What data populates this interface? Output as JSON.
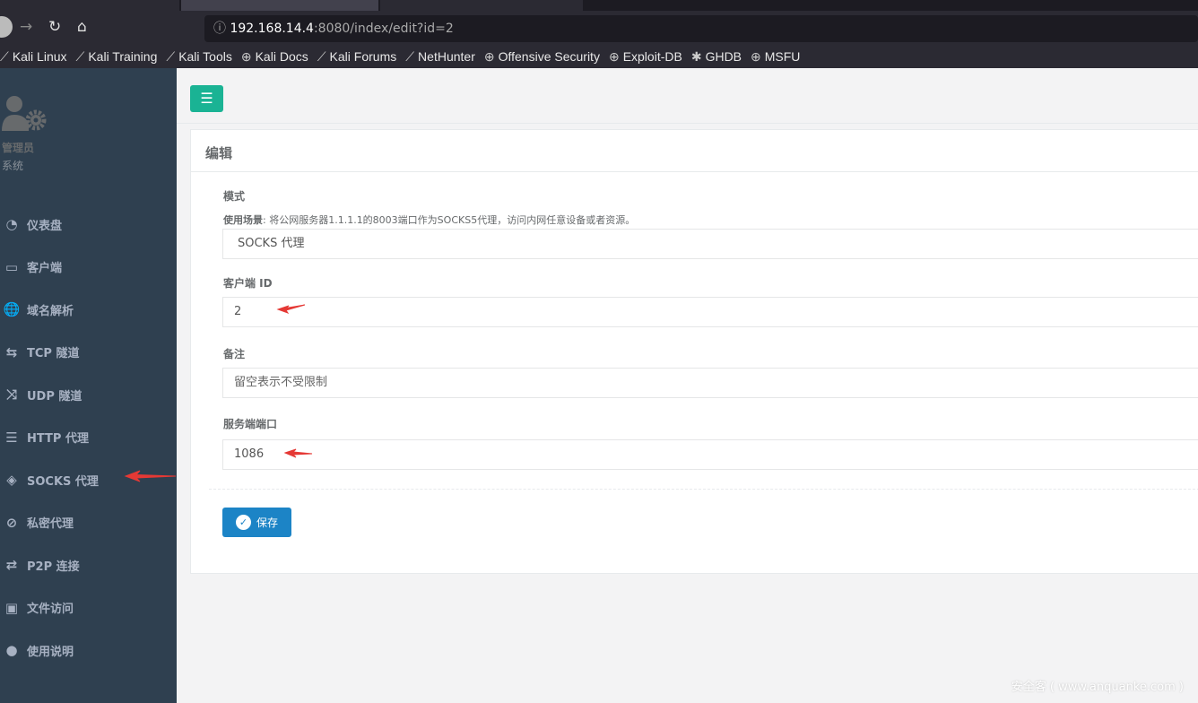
{
  "browser": {
    "url_host": "192.168.14.4",
    "url_rest": ":8080/index/edit?id=2",
    "bookmarks": [
      {
        "icon": "kali-dragon-icon",
        "label": "Kali Linux"
      },
      {
        "icon": "kali-dragon-icon",
        "label": "Kali Training"
      },
      {
        "icon": "kali-dragon-icon",
        "label": "Kali Tools"
      },
      {
        "icon": "globe-icon",
        "label": "Kali Docs"
      },
      {
        "icon": "kali-dragon-icon",
        "label": "Kali Forums"
      },
      {
        "icon": "kali-dragon-icon",
        "label": "NetHunter"
      },
      {
        "icon": "globe-icon",
        "label": "Offensive Security"
      },
      {
        "icon": "globe-icon",
        "label": "Exploit-DB"
      },
      {
        "icon": "ghdb-icon",
        "label": "GHDB"
      },
      {
        "icon": "globe-icon",
        "label": "MSFU"
      }
    ]
  },
  "profile": {
    "name": "管理员",
    "role": "系统"
  },
  "sidebar": {
    "items": [
      {
        "icon": "dashboard-icon",
        "label": "仪表盘"
      },
      {
        "icon": "desktop-icon",
        "label": "客户端"
      },
      {
        "icon": "globe-icon",
        "label": "域名解析"
      },
      {
        "icon": "retweet-icon",
        "label": "TCP 隧道"
      },
      {
        "icon": "random-icon",
        "label": "UDP 隧道"
      },
      {
        "icon": "server-icon",
        "label": "HTTP 代理"
      },
      {
        "icon": "layers-icon",
        "label": "SOCKS 代理"
      },
      {
        "icon": "eye-slash-icon",
        "label": "私密代理"
      },
      {
        "icon": "exchange-icon",
        "label": "P2P 连接"
      },
      {
        "icon": "briefcase-icon",
        "label": "文件访问"
      },
      {
        "icon": "lightbulb-icon",
        "label": "使用说明"
      }
    ]
  },
  "form": {
    "title": "编辑",
    "mode_label": "模式",
    "help_prefix": "使用场景",
    "help_text": ": 将公网服务器1.1.1.1的8003端口作为SOCKS5代理，访问内网任意设备或者资源。",
    "mode_value": "SOCKS 代理",
    "client_label": "客户端 ID",
    "client_value": "2",
    "remark_label": "备注",
    "remark_placeholder": "留空表示不受限制",
    "port_label": "服务端端口",
    "port_value": "1086",
    "save_label": "保存"
  },
  "watermark": "安全客 ( www.anquanke.com )",
  "colors": {
    "sidebar": "#2f4050",
    "primary": "#1ab394",
    "save": "#1c84c6",
    "annotation": "#e53935"
  }
}
